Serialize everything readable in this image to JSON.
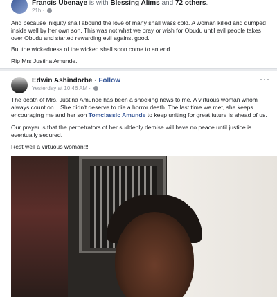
{
  "post1": {
    "author": "Francis Ubenaye",
    "with_text": " is with ",
    "tagged": "Blessing Alims",
    "and_text": " and ",
    "others": "72 others",
    "time": "21h",
    "p1": "And because iniquity shall abound the love of many shall wass cold. A woman killed and dumped inside well by her own son. This was not what we pray or wish for Obudu until evil people takes over Obudu and started rewarding evil against good.",
    "p2": "But the wickedness of the wicked shall soon come to an end.",
    "p3": "Rip Mrs Justina Amunde."
  },
  "post2": {
    "author": "Edwin Ashindorbe",
    "follow": "Follow",
    "time": "Yesterday at 10:46 AM",
    "p1a": "The death of Mrs. Justina Amunde has been a shocking news to me. A virtuous woman whom I always count on... She didn't deserve to die a horror death. The last time we met, she keeps encouraging me and her son ",
    "p1link": "Tomclassic Amunde",
    "p1b": " to keep uniting for great future is ahead of us.",
    "p2": "Our prayer is that the perpetrators of her suddenly demise will have no peace until justice is eventually secured.",
    "p3": "Rest well a virtuous woman!!!",
    "more": "···"
  },
  "icons": {
    "globe": "globe-icon",
    "more": "more-options-icon"
  }
}
